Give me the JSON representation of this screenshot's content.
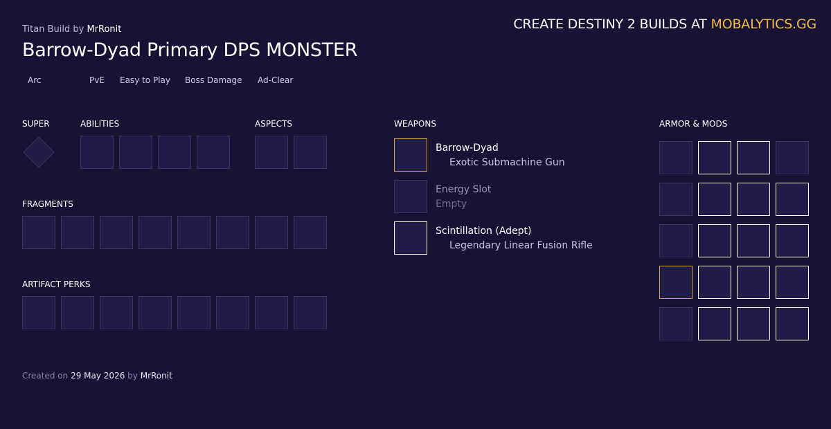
{
  "header": {
    "build_class": "Titan Build",
    "by_word": "by",
    "author": "MrRonit",
    "title": "Barrow-Dyad Primary DPS MONSTER",
    "promo_text": "CREATE DESTINY 2 BUILDS AT",
    "promo_brand": "MOBALYTICS.GG"
  },
  "tags": [
    "Arc",
    "PvE",
    "Easy to Play",
    "Boss Damage",
    "Ad-Clear"
  ],
  "sections": {
    "super": "SUPER",
    "abilities": "ABILITIES",
    "aspects": "ASPECTS",
    "fragments": "FRAGMENTS",
    "artifact_perks": "ARTIFACT PERKS",
    "weapons": "WEAPONS",
    "armor_mods": "ARMOR & MODS"
  },
  "weapons": [
    {
      "name": "Barrow-Dyad",
      "type": "Exotic Submachine Gun"
    },
    {
      "name": "Energy Slot",
      "type": "Empty"
    },
    {
      "name": "Scintillation (Adept)",
      "type": "Legendary Linear Fusion Rifle"
    }
  ],
  "footer": {
    "created_on": "Created on",
    "date": "29 May 2026",
    "by_word": "by",
    "author": "MrRonit"
  },
  "colors": {
    "background": "#181334",
    "slot": "#221d48",
    "accent": "#f2bc4e",
    "exotic_border": "#d4a84a"
  }
}
